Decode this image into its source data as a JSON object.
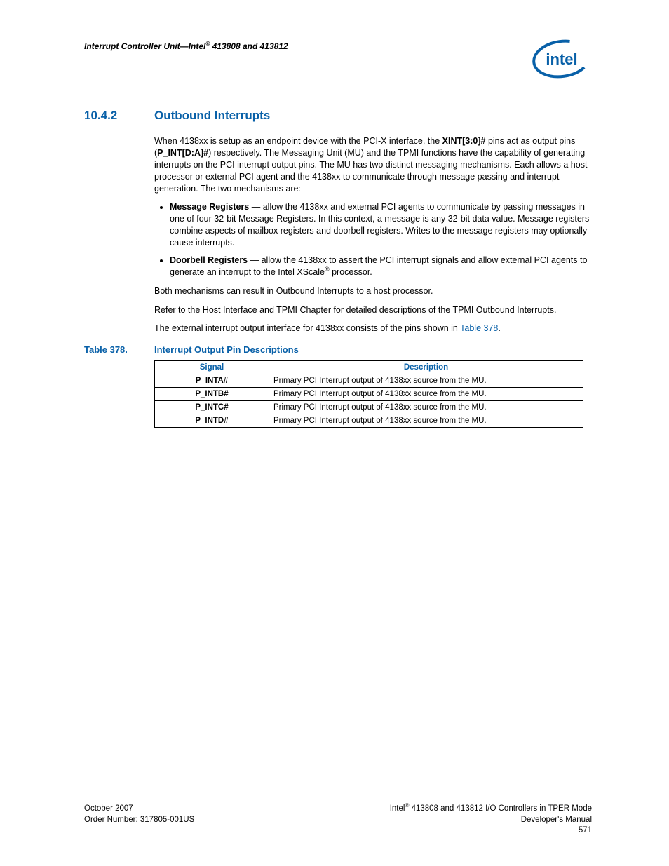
{
  "header": {
    "running_text_prefix": "Interrupt Controller Unit—Intel",
    "running_text_suffix": " 413808 and 413812",
    "reg_mark": "®"
  },
  "section": {
    "number": "10.4.2",
    "title": "Outbound Interrupts"
  },
  "paragraphs": {
    "p1_a": "When 4138xx is setup as an endpoint device with the PCI-X interface, the ",
    "p1_b": "XINT[3:0]#",
    "p1_c": " pins act as output pins (",
    "p1_d": "P_INT[D:A]#",
    "p1_e": ") respectively. The Messaging Unit (MU) and the TPMI functions have the capability of generating interrupts on the PCI interrupt output pins. The MU has two distinct messaging mechanisms. Each allows a host processor or external PCI agent and the 4138xx to communicate through message passing and interrupt generation. The two mechanisms are:",
    "li1_label": "Message Registers",
    "li1_body": " — allow the 4138xx and external PCI agents to communicate by passing messages in one of four 32-bit Message Registers. In this context, a message is any 32-bit data value. Message registers combine aspects of mailbox registers and doorbell registers. Writes to the message registers may optionally cause interrupts.",
    "li2_label": "Doorbell Registers",
    "li2_body_a": " — allow the 4138xx to assert the PCI interrupt signals and allow external PCI agents to generate an interrupt to the Intel XScale",
    "li2_reg": "®",
    "li2_body_b": " processor.",
    "p2": "Both mechanisms can result in Outbound Interrupts to a host processor.",
    "p3": "Refer to the Host Interface and TPMI Chapter for detailed descriptions of the TPMI Outbound Interrupts.",
    "p4_a": "The external interrupt output interface for 4138xx consists of the pins shown in ",
    "p4_link": "Table 378",
    "p4_b": "."
  },
  "table": {
    "label_num": "Table 378.",
    "label_title": "Interrupt Output Pin Descriptions",
    "col_signal": "Signal",
    "col_desc": "Description",
    "rows": [
      {
        "signal": "P_INTA#",
        "desc": "Primary PCI Interrupt output of 4138xx source from the MU."
      },
      {
        "signal": "P_INTB#",
        "desc": "Primary PCI Interrupt output of 4138xx source from the MU."
      },
      {
        "signal": "P_INTC#",
        "desc": "Primary PCI Interrupt output of 4138xx source from the MU."
      },
      {
        "signal": "P_INTD#",
        "desc": "Primary PCI Interrupt output of 4138xx source from the MU."
      }
    ]
  },
  "footer": {
    "left_line1": "October 2007",
    "left_line2": "Order Number: 317805-001US",
    "right_line1_a": "Intel",
    "right_line1_reg": "®",
    "right_line1_b": " 413808 and 413812 I/O Controllers in TPER Mode",
    "right_line2": "Developer's Manual",
    "right_line3": "571"
  }
}
